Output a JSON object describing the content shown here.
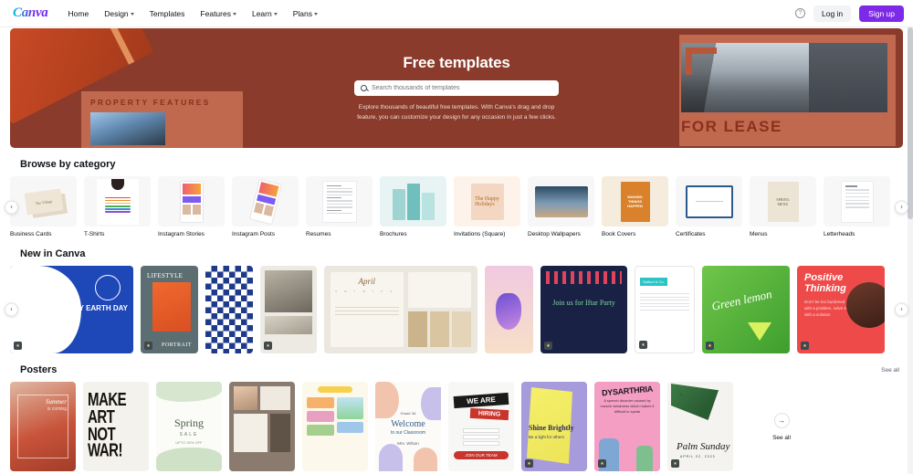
{
  "nav": {
    "logo": "Canva",
    "links": [
      {
        "label": "Home",
        "has_caret": false
      },
      {
        "label": "Design",
        "has_caret": true
      },
      {
        "label": "Templates",
        "has_caret": false
      },
      {
        "label": "Features",
        "has_caret": true
      },
      {
        "label": "Learn",
        "has_caret": true
      },
      {
        "label": "Plans",
        "has_caret": true
      }
    ],
    "help_icon": "?",
    "login_label": "Log in",
    "signup_label": "Sign up"
  },
  "hero": {
    "title": "Free templates",
    "search_placeholder": "Search thousands of templates",
    "search_value": "",
    "description": "Explore thousands of beautiful free templates. With Canva's drag and drop feature, you can customize your design for any occasion in just a few clicks.",
    "left_art_title": "PROPERTY FEATURES",
    "right_art_title": "FOR LEASE",
    "bg_color": "#8a3b2b"
  },
  "categories": {
    "section_title": "Browse by category",
    "items": [
      {
        "label": "Business Cards",
        "art": "business-card"
      },
      {
        "label": "T-Shirts",
        "art": "tshirt"
      },
      {
        "label": "Instagram Stories",
        "art": "phone"
      },
      {
        "label": "Instagram Posts",
        "art": "phone-tilt"
      },
      {
        "label": "Resumes",
        "art": "resume"
      },
      {
        "label": "Brochures",
        "art": "brochure"
      },
      {
        "label": "Invitations (Square)",
        "art": "invitation"
      },
      {
        "label": "Desktop Wallpapers",
        "art": "wallpaper"
      },
      {
        "label": "Book Covers",
        "art": "bookcover"
      },
      {
        "label": "Certificates",
        "art": "certificate"
      },
      {
        "label": "Menus",
        "art": "menu"
      },
      {
        "label": "Letterheads",
        "art": "letterhead"
      }
    ]
  },
  "new_in_canva": {
    "section_title": "New in Canva",
    "items": [
      {
        "art": "earth-day",
        "title": "HAPPY EARTH DAY",
        "badge": "star"
      },
      {
        "art": "lifestyle",
        "title": "LIFESTYLE",
        "subtitle": "PORTRAIT",
        "badge": "star"
      },
      {
        "art": "pattern",
        "title": "",
        "badge": ""
      },
      {
        "art": "architecture",
        "title": "",
        "badge": "star"
      },
      {
        "art": "april-planner",
        "title": "April",
        "badge": ""
      },
      {
        "art": "abstract",
        "title": "",
        "badge": ""
      },
      {
        "art": "iftar",
        "title": "Join us for Iftar Party",
        "badge": "star"
      },
      {
        "art": "letterhead-doc",
        "title": "Salford & Co.",
        "badge": "star"
      },
      {
        "art": "green-lemon",
        "title": "Green lemon",
        "badge": "star"
      },
      {
        "art": "positive",
        "title": "Positive Thinking",
        "subtitle": "Don't be too burdened with a problem, solve it with a solution",
        "badge": "star"
      }
    ],
    "arrow_left": "‹",
    "arrow_right": "›"
  },
  "posters": {
    "section_title": "Posters",
    "see_all_label": "See all",
    "items": [
      {
        "art": "summer",
        "title": "Summer",
        "subtitle": "is coming",
        "badge": ""
      },
      {
        "art": "make-art",
        "title": "MAKE ART NOT WAR!",
        "badge": ""
      },
      {
        "art": "spring-sale",
        "title": "Spring",
        "subtitle": "SALE",
        "extra": "UPTO 50% OFF",
        "badge": ""
      },
      {
        "art": "moodboard",
        "title": "",
        "badge": ""
      },
      {
        "art": "lesson-plan",
        "title": "",
        "badge": ""
      },
      {
        "art": "classroom",
        "title": "Welcome",
        "subtitle": "to our Classroom",
        "extra": "Mrs. Wilson",
        "badge": ""
      },
      {
        "art": "hiring",
        "title": "WE ARE",
        "subtitle": "HIRING",
        "extra": "JOIN OUR TEAM",
        "badge": ""
      },
      {
        "art": "shine",
        "title": "Shine Brightly",
        "subtitle": "Be a light for others",
        "badge": "star"
      },
      {
        "art": "dysarthria",
        "title": "DYSARTHRIA",
        "subtitle": "A speech disorder caused by muscle weakness which makes it difficult to speak",
        "badge": "star"
      },
      {
        "art": "palm-sunday",
        "title": "Palm Sunday",
        "subtitle": "APRIL 02, 2023",
        "badge": "star"
      }
    ],
    "see_all_tile_label": "See all",
    "see_all_arrow": "→"
  }
}
